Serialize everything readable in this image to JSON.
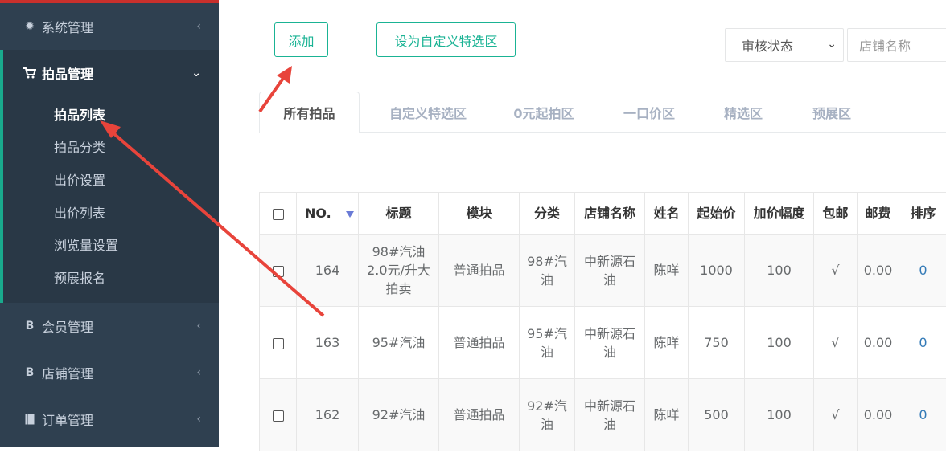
{
  "sidebar": {
    "items": [
      {
        "icon": "gear-icon",
        "label": "系统管理"
      },
      {
        "icon": "cart-icon",
        "label": "拍品管理"
      },
      {
        "icon": "bitcoin-icon",
        "label": "会员管理"
      },
      {
        "icon": "bitcoin-icon",
        "label": "店铺管理"
      },
      {
        "icon": "book-icon",
        "label": "订单管理"
      }
    ],
    "subitems": [
      "拍品列表",
      "拍品分类",
      "出价设置",
      "出价列表",
      "浏览量设置",
      "预展报名"
    ]
  },
  "toolbar": {
    "add_label": "添加",
    "set_custom_label": "设为自定义特选区",
    "status_select": "审核状态",
    "shop_placeholder": "店铺名称"
  },
  "tabs": [
    "所有拍品",
    "自定义特选区",
    "0元起拍区",
    "一口价区",
    "精选区",
    "预展区"
  ],
  "table": {
    "columns": [
      "NO.",
      "标题",
      "模块",
      "分类",
      "店铺名称",
      "姓名",
      "起始价",
      "加价幅度",
      "包邮",
      "邮费",
      "排序"
    ],
    "rows": [
      {
        "no": "164",
        "title": "98#汽油2.0元/升大拍卖",
        "module": "普通拍品",
        "category": "98#汽油",
        "shop": "中新源石油",
        "name": "陈咩",
        "start": "1000",
        "increment": "100",
        "free_ship": "√",
        "postage": "0.00",
        "order": "0"
      },
      {
        "no": "163",
        "title": "95#汽油",
        "module": "普通拍品",
        "category": "95#汽油",
        "shop": "中新源石油",
        "name": "陈咩",
        "start": "750",
        "increment": "100",
        "free_ship": "√",
        "postage": "0.00",
        "order": "0"
      },
      {
        "no": "162",
        "title": "92#汽油",
        "module": "普通拍品",
        "category": "92#汽油",
        "shop": "中新源石油",
        "name": "陈咩",
        "start": "500",
        "increment": "100",
        "free_ship": "√",
        "postage": "0.00",
        "order": "0"
      }
    ]
  },
  "colors": {
    "sidebar_bg": "#2f4050",
    "accent": "#1ab394",
    "annotation_arrow": "#e8443b"
  }
}
